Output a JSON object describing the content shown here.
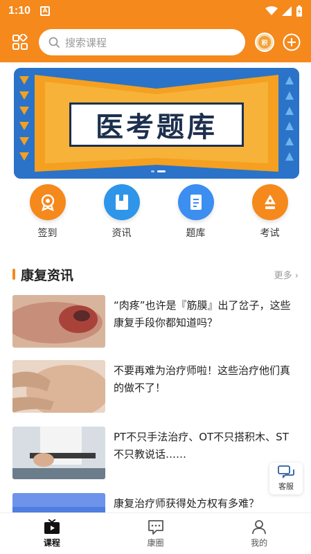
{
  "status_bar": {
    "time": "1:10",
    "notification_letter": "A"
  },
  "search": {
    "placeholder": "搜索课程"
  },
  "coin": {
    "label": "积"
  },
  "banner": {
    "title": "医考题库"
  },
  "quick_links": [
    {
      "label": "签到",
      "icon": "badge-icon",
      "color": "#f5891c"
    },
    {
      "label": "资讯",
      "icon": "book-icon",
      "color": "#2f95e8"
    },
    {
      "label": "题库",
      "icon": "scroll-icon",
      "color": "#3c8ef0"
    },
    {
      "label": "考试",
      "icon": "pen-nib-icon",
      "color": "#f5891c"
    }
  ],
  "section": {
    "title": "康复资讯",
    "more": "更多"
  },
  "news": [
    {
      "title": "“肉疼”也许是『筋膜』出了岔子，这些康复手段你都知道吗？"
    },
    {
      "title": "不要再难为治疗师啦！这些治疗他们真的做不了！"
    },
    {
      "title": "PT不只手法治疗、OT不只搭积木、ST不只教说话……"
    },
    {
      "title": "康复治疗师获得处方权有多难？"
    }
  ],
  "customer_service": {
    "label": "客服"
  },
  "tabs": [
    {
      "label": "课程",
      "active": true
    },
    {
      "label": "康圈",
      "active": false
    },
    {
      "label": "我的",
      "active": false
    }
  ],
  "colors": {
    "accent": "#f5891c",
    "banner_blue": "#2a73c8"
  }
}
